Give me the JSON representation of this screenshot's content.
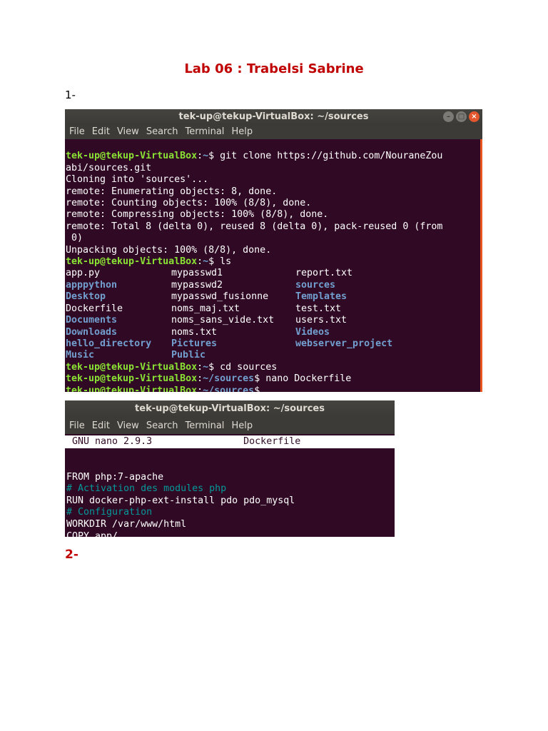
{
  "document": {
    "title": "Lab 06 : Trabelsi Sabrine",
    "section1": "1-",
    "section2": "2-"
  },
  "terminal1": {
    "title": "tek-up@tekup-VirtualBox: ~/sources",
    "menu": [
      "File",
      "Edit",
      "View",
      "Search",
      "Terminal",
      "Help"
    ],
    "prompt_user": "tek-up@tekup-VirtualBox",
    "prompt_home": "~",
    "prompt_sources": "~/sources",
    "lines": {
      "cmd1": "$ git clone https://github.com/NouraneZou",
      "cmd1_wrap": "abi/sources.git",
      "out1": "Cloning into 'sources'...",
      "out2": "remote: Enumerating objects: 8, done.",
      "out3": "remote: Counting objects: 100% (8/8), done.",
      "out4": "remote: Compressing objects: 100% (8/8), done.",
      "out5": "remote: Total 8 (delta 0), reused 8 (delta 0), pack-reused 0 (from",
      "out5_wrap": " 0)",
      "out6": "Unpacking objects: 100% (8/8), done.",
      "cmd2": "$ ls",
      "cmd3": "$ cd sources",
      "cmd4": "$ nano Dockerfile",
      "cmd5": "$"
    },
    "ls": [
      [
        "app.py",
        "mypasswd1",
        "report.txt"
      ],
      [
        "apppython",
        "mypasswd2",
        "sources"
      ],
      [
        "Desktop",
        "mypasswd_fusionne",
        "Templates"
      ],
      [
        "Dockerfile",
        "noms_maj.txt",
        "test.txt"
      ],
      [
        "Documents",
        "noms_sans_vide.txt",
        "users.txt"
      ],
      [
        "Downloads",
        "noms.txt",
        "Videos"
      ],
      [
        "hello_directory",
        "Pictures",
        "webserver_project"
      ],
      [
        "Music",
        "Public",
        ""
      ]
    ],
    "colors": {
      "background": "#300a24",
      "prompt_user": "#8ae234",
      "prompt_path": "#729fcf",
      "directory": "#729fcf",
      "accent": "#e95420"
    }
  },
  "terminal2": {
    "title": "tek-up@tekup-VirtualBox: ~/sources",
    "menu": [
      "File",
      "Edit",
      "View",
      "Search",
      "Terminal",
      "Help"
    ],
    "nano_header": " GNU nano 2.9.3                Dockerfile",
    "lines": {
      "l1": "FROM php:7-apache",
      "l2": "# Activation des modules php",
      "l3": "RUN docker-php-ext-install pdo pdo_mysql",
      "l4": "# Configuration",
      "l5": "WORKDIR /var/www/html",
      "l6": "COPY app/"
    },
    "colors": {
      "comment": "#06989a"
    }
  }
}
